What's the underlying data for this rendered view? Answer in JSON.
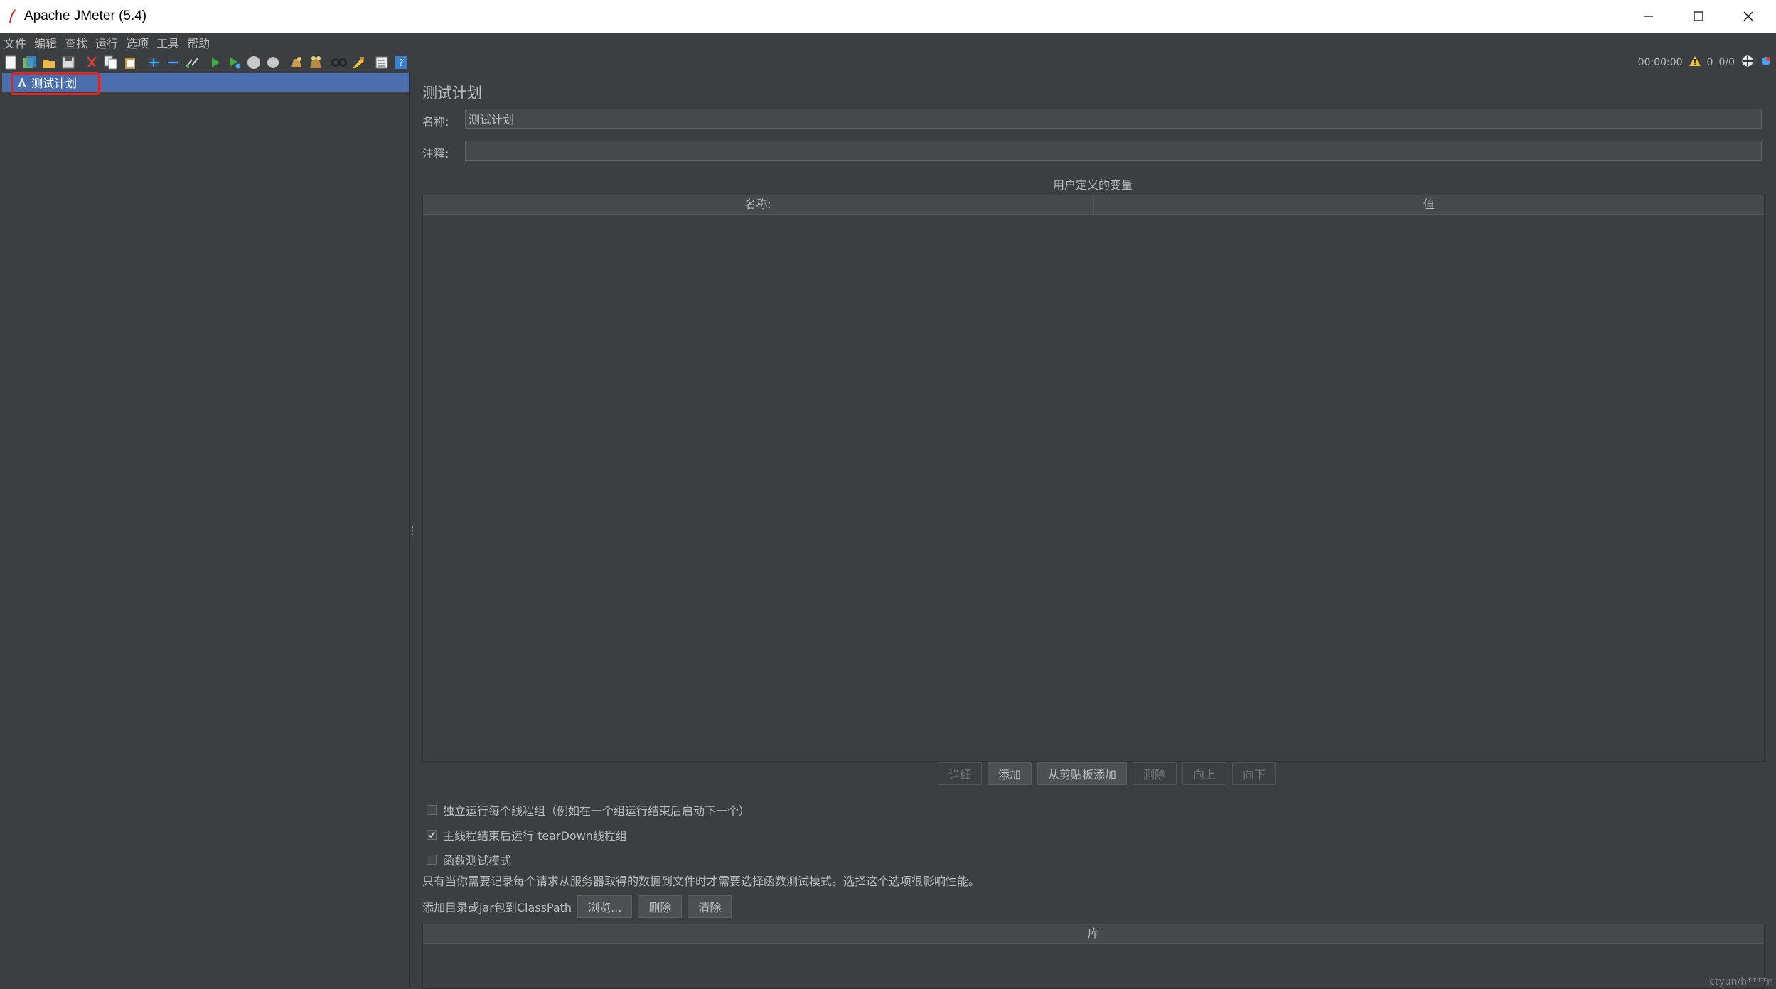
{
  "window": {
    "title": "Apache JMeter (5.4)"
  },
  "menu": [
    "文件",
    "编辑",
    "查找",
    "运行",
    "选项",
    "工具",
    "帮助"
  ],
  "toolbar": {
    "icons": [
      "new-icon",
      "templates-icon",
      "open-icon",
      "save-icon",
      "cut-icon",
      "copy-icon",
      "paste-icon",
      "expand-icon",
      "collapse-icon",
      "toggle-icon",
      "start-icon",
      "start-no-pause-icon",
      "stop-icon",
      "shutdown-icon",
      "clear-icon",
      "clear-all-icon",
      "search-icon",
      "reset-search-icon",
      "function-helper-icon",
      "help-icon"
    ],
    "status": {
      "elapsed": "00:00:00",
      "warnings": "0",
      "threads": "0/0"
    }
  },
  "tree": {
    "selected": "测试计划"
  },
  "main": {
    "title": "测试计划",
    "name_label": "名称:",
    "name_value": "测试计划",
    "comment_label": "注释:",
    "comment_value": "",
    "vars_title": "用户定义的变量",
    "vars_columns": [
      "名称:",
      "值"
    ],
    "buttons": {
      "detail": "详细",
      "add": "添加",
      "add_clipboard": "从剪贴板添加",
      "delete": "删除",
      "up": "向上",
      "down": "向下"
    },
    "options": {
      "serialize": {
        "label": "独立运行每个线程组（例如在一个组运行结束后启动下一个）",
        "checked": false
      },
      "teardown": {
        "label": "主线程结束后运行 tearDown线程组",
        "checked": true
      },
      "functional": {
        "label": "函数测试模式",
        "checked": false
      }
    },
    "note": "只有当你需要记录每个请求从服务器取得的数据到文件时才需要选择函数测试模式。选择这个选项很影响性能。",
    "classpath": {
      "label": "添加目录或jar包到ClassPath",
      "browse": "浏览...",
      "delete": "删除",
      "clear": "清除"
    },
    "lib_column": "库"
  },
  "watermark": "ctyun/h****n"
}
